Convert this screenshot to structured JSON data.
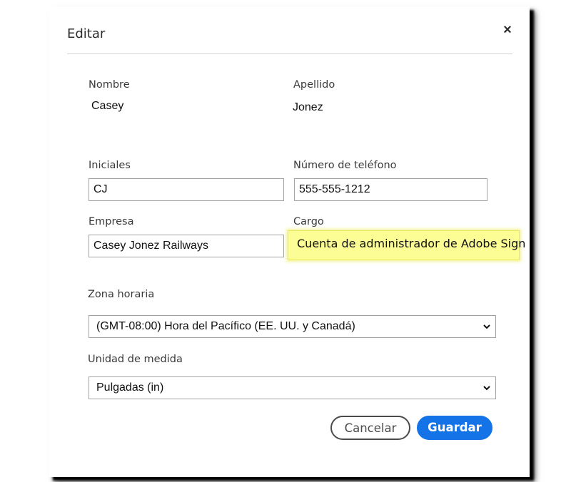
{
  "dialog": {
    "title": "Editar",
    "close_label": "×"
  },
  "form": {
    "first_name": {
      "label": "Nombre",
      "value": "Casey"
    },
    "last_name": {
      "label": "Apellido",
      "value": "Jonez"
    },
    "initials": {
      "label": "Iniciales",
      "value": "CJ"
    },
    "phone": {
      "label": "Número de teléfono",
      "value": "555-555-1212"
    },
    "company": {
      "label": "Empresa",
      "value": "Casey Jonez Railways"
    },
    "position": {
      "label": "Cargo",
      "value": "Cuenta de administrador de Adobe Sign"
    },
    "timezone": {
      "label": "Zona horaria",
      "value": "(GMT-08:00) Hora del Pacífico (EE. UU. y Canadá)"
    },
    "unit": {
      "label": "Unidad de medida",
      "value": "Pulgadas (in)"
    }
  },
  "buttons": {
    "cancel": "Cancelar",
    "save": "Guardar"
  },
  "colors": {
    "primary": "#1473e6",
    "highlight": "#fdfd96"
  },
  "icons": {
    "close": "close-icon",
    "dropdown": "chevron-down-icon"
  }
}
